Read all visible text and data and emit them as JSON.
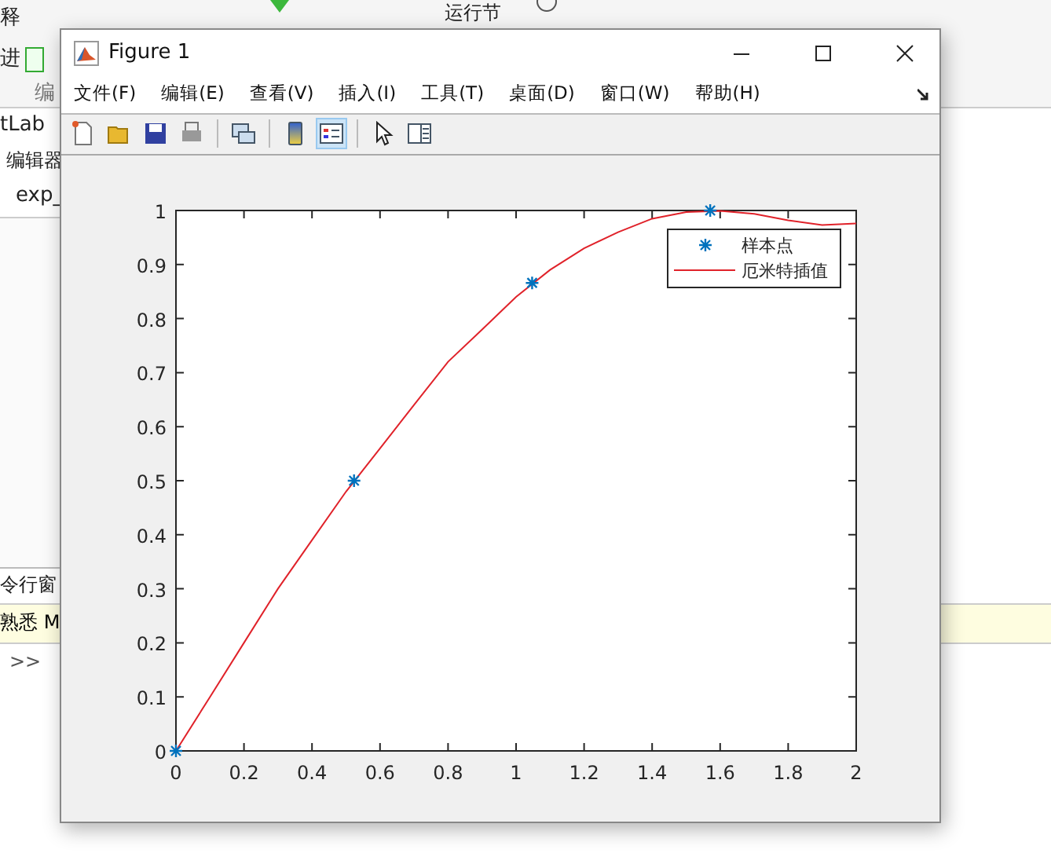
{
  "background": {
    "toolbar_texts": [
      "释",
      "进",
      "编"
    ],
    "section_label": "运行节",
    "left_texts": [
      "tLab",
      "编辑器",
      "exp_"
    ],
    "command_window_title": "令行窗",
    "notice": "熟悉 M",
    "prompt": ">>"
  },
  "window": {
    "title": "Figure 1"
  },
  "menu": [
    "文件(F)",
    "编辑(E)",
    "查看(V)",
    "插入(I)",
    "工具(T)",
    "桌面(D)",
    "窗口(W)",
    "帮助(H)"
  ],
  "toolbar": [
    {
      "kind": "new",
      "selected": false
    },
    {
      "kind": "open",
      "selected": false
    },
    {
      "kind": "save",
      "selected": false
    },
    {
      "kind": "print",
      "selected": false
    },
    {
      "kind": "sep"
    },
    {
      "kind": "link",
      "selected": false
    },
    {
      "kind": "sep"
    },
    {
      "kind": "colorbar",
      "selected": false
    },
    {
      "kind": "legend",
      "selected": true
    },
    {
      "kind": "sep"
    },
    {
      "kind": "pointer",
      "selected": false
    },
    {
      "kind": "panel",
      "selected": false
    }
  ],
  "chart_data": {
    "type": "line",
    "legend": "upper right",
    "xlim": [
      0,
      2
    ],
    "ylim": [
      0,
      1
    ],
    "xticks": [
      0,
      0.2,
      0.4,
      0.6,
      0.8,
      1,
      1.2,
      1.4,
      1.6,
      1.8,
      2
    ],
    "yticks": [
      0,
      0.1,
      0.2,
      0.3,
      0.4,
      0.5,
      0.6,
      0.7,
      0.8,
      0.9,
      1
    ],
    "series": [
      {
        "name": "样本点",
        "color": "#0072bd",
        "type": "scatter",
        "x": [
          0,
          0.5236,
          1.0472,
          1.5708
        ],
        "values": [
          0,
          0.5,
          0.866,
          1
        ]
      },
      {
        "name": "厄米特插值",
        "color": "#e0222a",
        "type": "line",
        "x": [
          0,
          0.1,
          0.2,
          0.3,
          0.4,
          0.5,
          0.6,
          0.7,
          0.8,
          0.9,
          1,
          1.1,
          1.2,
          1.3,
          1.4,
          1.5,
          1.6,
          1.7,
          1.8,
          1.9,
          2
        ],
        "values": [
          0,
          0.1,
          0.2,
          0.3,
          0.39,
          0.48,
          0.56,
          0.64,
          0.72,
          0.78,
          0.84,
          0.89,
          0.93,
          0.96,
          0.985,
          0.997,
          0.999,
          0.994,
          0.982,
          0.973,
          0.976
        ]
      }
    ]
  }
}
